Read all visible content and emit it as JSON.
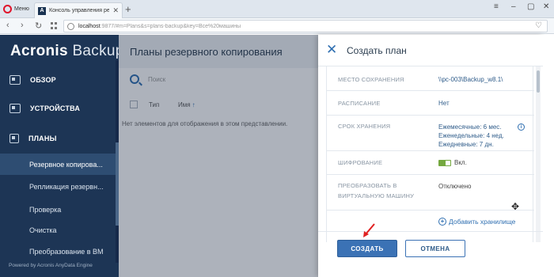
{
  "browser": {
    "menu_label": "Меню",
    "tab_title": "Консоль управления резер",
    "tab_favicon_letter": "A",
    "new_tab_glyph": "+",
    "url_host": "localhost",
    "url_path": ":9877/#m=Plans&s=plans-backup&key=Все%20машины"
  },
  "sidebar": {
    "logo_a": "Acronis",
    "logo_b": "Backup",
    "sections": [
      {
        "label": "ОБЗОР",
        "icon": "dashboard-icon"
      },
      {
        "label": "УСТРОЙСТВА",
        "icon": "devices-icon"
      },
      {
        "label": "ПЛАНЫ",
        "icon": "plans-icon"
      }
    ],
    "items": [
      {
        "label": "Резервное копирова..."
      },
      {
        "label": "Репликация резервн..."
      },
      {
        "label": "Проверка"
      },
      {
        "label": "Очистка"
      },
      {
        "label": "Преобразование в ВМ"
      }
    ],
    "powered_by": "Powered by Acronis AnyData Engine"
  },
  "main": {
    "title": "Планы резервного копирования",
    "search_placeholder": "Поиск",
    "columns": {
      "type": "Тип",
      "name": "Имя"
    },
    "empty_message": "Нет элементов для отображения в этом представлении."
  },
  "panel": {
    "title": "Создать план",
    "settings": {
      "storage_label": "МЕСТО СОХРАНЕНИЯ",
      "storage_value": "\\\\pc-003\\Backup_w8.1\\",
      "schedule_label": "РАСПИСАНИЕ",
      "schedule_value": "Нет",
      "retention_label": "СРОК ХРАНЕНИЯ",
      "retention_monthly": "Ежемесячные: 6 мес.",
      "retention_weekly": "Еженедельные: 4 нед.",
      "retention_daily": "Ежедневные: 7 дн.",
      "encryption_label": "ШИФРОВАНИЕ",
      "encryption_value": "Вкл.",
      "convert_label_1": "ПРЕОБРАЗОВАТЬ В",
      "convert_label_2": "ВИРТУАЛЬНУЮ МАШИНУ",
      "convert_value": "Отключено"
    },
    "add_storage": "Добавить хранилище",
    "create_button": "СОЗДАТЬ",
    "cancel_button": "ОТМЕНА"
  },
  "colors": {
    "sidebar_bg": "#1d3555",
    "accent": "#3b72b5",
    "toggle_on": "#74a83f",
    "arrow": "#e02020"
  }
}
